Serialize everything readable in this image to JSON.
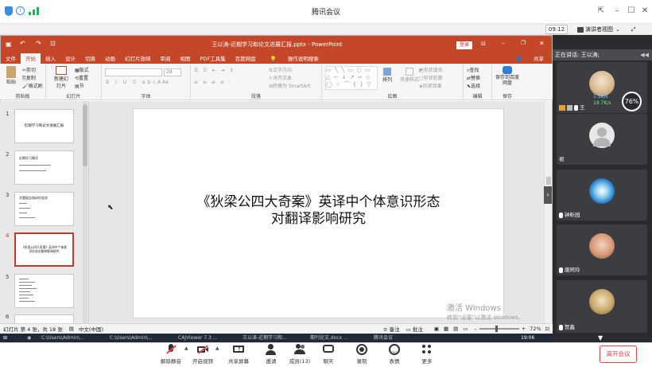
{
  "meeting": {
    "title": "腾讯会议",
    "timer": "09:12",
    "speaker_view": "演讲者视图",
    "currently_speaking": "正在讲话: 王以涛;",
    "leave_label": "离开会议",
    "toolbar": [
      {
        "label": "解除静音",
        "icon": "mic-muted-icon"
      },
      {
        "label": "开启视频",
        "icon": "camera-off-icon"
      },
      {
        "label": "共享屏幕",
        "icon": "share-screen-icon"
      },
      {
        "label": "邀请",
        "icon": "invite-icon"
      },
      {
        "label": "成员(13)",
        "icon": "members-icon"
      },
      {
        "label": "聊天",
        "icon": "chat-icon"
      },
      {
        "label": "录制",
        "icon": "record-icon"
      },
      {
        "label": "表情",
        "icon": "emoji-icon"
      },
      {
        "label": "更多",
        "icon": "more-icon"
      }
    ],
    "participants": [
      {
        "name": "王",
        "stats_up": "1.5K/s",
        "stats_down": "19.7K/s",
        "gauge": "76%"
      },
      {
        "name": "祝"
      },
      {
        "name": "钟昕园"
      },
      {
        "name": "唐珂玲"
      },
      {
        "name": "贺鑫"
      }
    ]
  },
  "ppt": {
    "window_title": "王以涛-近期学习和论文进展汇报.pptx - PowerPoint",
    "login": "登录",
    "share": "共享",
    "tabs": [
      "文件",
      "开始",
      "插入",
      "设计",
      "切换",
      "动画",
      "幻灯片放映",
      "审阅",
      "视图",
      "PDF工具集",
      "百度网盘"
    ],
    "tell_me": "操作说明搜索",
    "ribbon": {
      "paste": "粘贴",
      "cut": "剪切",
      "copy": "复制",
      "format_painter": "格式刷",
      "clipboard": "剪贴板",
      "new_slide": "新建幻灯片",
      "layout": "版式",
      "reset": "重置",
      "section": "节",
      "slides": "幻灯片",
      "font_size": "28",
      "font_group": "字体",
      "text_direction": "文字方向",
      "align_text": "对齐文本",
      "smartart": "转换为 SmartArt",
      "paragraph": "段落",
      "arrange": "排列",
      "quick_styles": "快速样式",
      "shape_fill": "形状填充",
      "shape_outline": "形状轮廓",
      "shape_effects": "形状效果",
      "drawing": "绘图",
      "find": "查找",
      "replace": "替换",
      "select": "选择",
      "editing": "编辑",
      "save_baidu": "保存到百度网盘",
      "save": "保存"
    },
    "thumbnails": [
      {
        "num": "1",
        "text": "近期学习和论文进展汇报"
      },
      {
        "num": "2",
        "text": "近期学习情况"
      },
      {
        "num": "3",
        "text": "开题报告和研究现状"
      },
      {
        "num": "4",
        "text": "《狄梁公四大奇案》英译中个体意识形态对翻译影响研究"
      },
      {
        "num": "5",
        "text": ""
      },
      {
        "num": "6",
        "text": ""
      }
    ],
    "slide_title_line1": "《狄梁公四大奇案》英译中个体意识形态",
    "slide_title_line2": "对翻译影响研究",
    "status": {
      "slide_info": "幻灯片 第 4 张，共 18 张",
      "language": "中文(中国)",
      "notes": "备注",
      "comments": "批注",
      "zoom": "72%"
    },
    "activate_line1": "激活 Windows",
    "activate_line2": "转到“设置”以激活 Windows。"
  },
  "taskbar": {
    "items": [
      "C:\\Users\\Admin\\...",
      "C:\\Users\\Admin\\...",
      "CAJViewer 7.3 ...",
      "王以涛-近期学习和...",
      "期刊论文.docx ...",
      "腾讯会议"
    ],
    "time": "19:06"
  },
  "colors": {
    "ppt_accent": "#c4472a",
    "meeting_blue": "#3a8de0",
    "leave_red": "#e04848"
  }
}
